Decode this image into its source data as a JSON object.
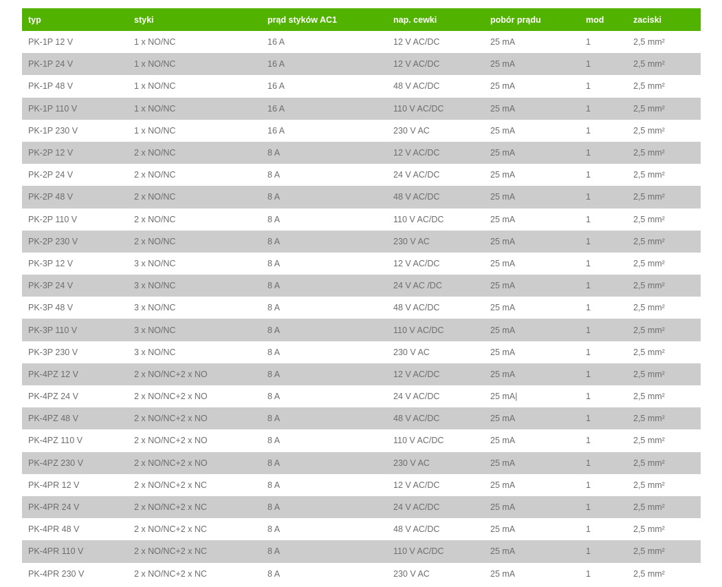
{
  "table": {
    "headers": [
      "typ",
      "styki",
      "prąd styków AC1",
      "nap. cewki",
      "pobór prądu",
      "mod",
      "zaciski"
    ],
    "rows": [
      [
        "PK-1P 12 V",
        "1 x NO/NC",
        "16 A",
        "12 V AC/DC",
        "25 mA",
        "1",
        "2,5 mm²"
      ],
      [
        "PK-1P 24 V",
        "1 x NO/NC",
        "16 A",
        "12 V AC/DC",
        "25 mA",
        "1",
        "2,5 mm²"
      ],
      [
        "PK-1P 48 V",
        "1 x NO/NC",
        "16 A",
        "48 V AC/DC",
        "25 mA",
        "1",
        "2,5 mm²"
      ],
      [
        "PK-1P 110 V",
        "1 x NO/NC",
        "16 A",
        "110 V AC/DC",
        "25 mA",
        "1",
        "2,5 mm²"
      ],
      [
        "PK-1P 230 V",
        "1 x NO/NC",
        "16 A",
        "230 V AC",
        "25 mA",
        "1",
        "2,5 mm²"
      ],
      [
        "PK-2P 12 V",
        "2 x NO/NC",
        "8 A",
        "12 V AC/DC",
        "25 mA",
        "1",
        "2,5 mm²"
      ],
      [
        "PK-2P 24 V",
        "2 x NO/NC",
        "8 A",
        "24 V AC/DC",
        "25 mA",
        "1",
        "2,5 mm²"
      ],
      [
        "PK-2P 48 V",
        "2 x NO/NC",
        "8 A",
        "48 V AC/DC",
        "25 mA",
        "1",
        "2,5 mm²"
      ],
      [
        "PK-2P 110 V",
        "2 x NO/NC",
        "8 A",
        "110 V AC/DC",
        "25 mA",
        "1",
        "2,5 mm²"
      ],
      [
        "PK-2P 230 V",
        "2 x NO/NC",
        "8 A",
        "230 V AC",
        "25 mA",
        "1",
        "2,5 mm²"
      ],
      [
        "PK-3P 12 V",
        "3 x NO/NC",
        "8 A",
        "12 V AC/DC",
        "25 mA",
        "1",
        "2,5 mm²"
      ],
      [
        "PK-3P 24 V",
        "3 x NO/NC",
        "8 A",
        "24 V AC /DC",
        "25 mA",
        "1",
        "2,5 mm²"
      ],
      [
        "PK-3P 48 V",
        "3 x NO/NC",
        "8 A",
        "48 V AC/DC",
        "25 mA",
        "1",
        "2,5 mm²"
      ],
      [
        "PK-3P 110 V",
        "3 x NO/NC",
        "8 A",
        "110 V AC/DC",
        "25 mA",
        "1",
        "2,5 mm²"
      ],
      [
        "PK-3P 230 V",
        "3 x NO/NC",
        "8 A",
        "230 V AC",
        "25 mA",
        "1",
        "2,5 mm²"
      ],
      [
        "PK-4PZ 12 V",
        "2 x NO/NC+2 x NO",
        "8 A",
        "12 V AC/DC",
        "25 mA",
        "1",
        "2,5 mm²"
      ],
      [
        "PK-4PZ 24 V",
        "2 x NO/NC+2 x NO",
        "8 A",
        "24 V AC/DC",
        "25 mA|",
        "1",
        "2,5 mm²"
      ],
      [
        "PK-4PZ 48 V",
        "2 x NO/NC+2 x NO",
        "8 A",
        "48 V AC/DC",
        "25 mA",
        "1",
        "2,5 mm²"
      ],
      [
        "PK-4PZ 110 V",
        "2 x NO/NC+2 x NO",
        "8 A",
        "110 V AC/DC",
        "25 mA",
        "1",
        "2,5 mm²"
      ],
      [
        "PK-4PZ 230 V",
        "2 x NO/NC+2 x NO",
        "8 A",
        "230 V AC",
        "25 mA",
        "1",
        "2,5 mm²"
      ],
      [
        "PK-4PR 12 V",
        "2 x NO/NC+2 x NC",
        "8 A",
        "12 V AC/DC",
        "25 mA",
        "1",
        "2,5 mm²"
      ],
      [
        "PK-4PR 24 V",
        "2 x NO/NC+2 x NC",
        "8 A",
        "24 V AC/DC",
        "25 mA",
        "1",
        "2,5 mm²"
      ],
      [
        "PK-4PR 48 V",
        "2 x NO/NC+2 x NC",
        "8 A",
        "48 V AC/DC",
        "25 mA",
        "1",
        "2,5 mm²"
      ],
      [
        "PK-4PR 110 V",
        "2 x NO/NC+2 x NC",
        "8 A",
        "110 V AC/DC",
        "25 mA",
        "1",
        "2,5 mm²"
      ],
      [
        "PK-4PR 230 V",
        "2 x NO/NC+2 x NC",
        "8 A",
        "230 V AC",
        "25 mA",
        "1",
        "2,5 mm²"
      ]
    ]
  },
  "colors": {
    "header_bg": "#52b200",
    "header_text": "#ffffff",
    "row_alt_bg": "#cccccc",
    "row_bg": "#ffffff",
    "cell_text": "#6d6d6d"
  }
}
